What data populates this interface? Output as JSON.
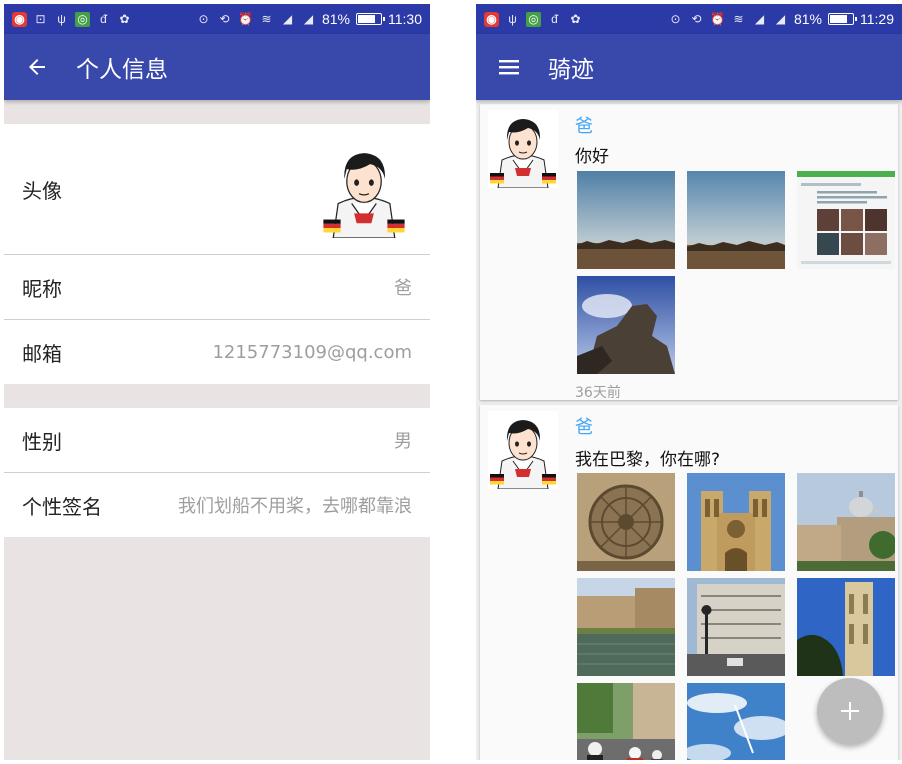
{
  "left": {
    "statusbar": {
      "left_icons": [
        "netease-music-icon",
        "screenshot-icon",
        "usb-icon",
        "camera-app-icon",
        "baidu-icon",
        "android-debug-icon"
      ],
      "right_icons": [
        "location-icon",
        "rotation-icon",
        "alarm-icon",
        "wifi-icon",
        "signal-icon",
        "signal-icon"
      ],
      "battery_text": "81%",
      "battery_level": 0.81,
      "time": "11:30"
    },
    "toolbar": {
      "title": "个人信息",
      "nav_icon": "back-arrow-icon"
    },
    "rows": {
      "avatar_label": "头像",
      "nickname_label": "昵称",
      "nickname_value": "爸",
      "email_label": "邮箱",
      "email_value": "1215773109@qq.com",
      "gender_label": "性别",
      "gender_value": "男",
      "signature_label": "个性签名",
      "signature_value": "我们划船不用桨，去哪都靠浪"
    }
  },
  "right": {
    "statusbar": {
      "left_icons": [
        "netease-music-icon",
        "usb-icon",
        "camera-app-icon",
        "baidu-icon",
        "android-debug-icon"
      ],
      "right_icons": [
        "location-icon",
        "rotation-icon",
        "alarm-icon",
        "wifi-icon",
        "signal-icon",
        "signal-icon"
      ],
      "battery_text": "81%",
      "battery_level": 0.81,
      "time": "11:29"
    },
    "toolbar": {
      "title": "骑迹",
      "nav_icon": "menu-icon"
    },
    "posts": [
      {
        "user": "爸",
        "text": "你好",
        "time": "36天前",
        "photos": [
          "city-skyline-photo",
          "city-skyline-photo",
          "chat-screenshot-photo",
          "sculpture-photo"
        ]
      },
      {
        "user": "爸",
        "text": "我在巴黎，你在哪?",
        "photos": [
          "rose-window-photo",
          "notre-dame-photo",
          "dome-photo",
          "seine-river-photo",
          "paris-street-photo",
          "tower-photo",
          "street-scooters-photo",
          "sky-plane-photo"
        ]
      }
    ],
    "fab_icon": "plus-icon"
  },
  "colors": {
    "statusbar": "#2b3aa6",
    "toolbar": "#3949ab",
    "username": "#42a5f5",
    "hint_text": "#9e9e9e",
    "background_grey": "#e9e4e3"
  }
}
